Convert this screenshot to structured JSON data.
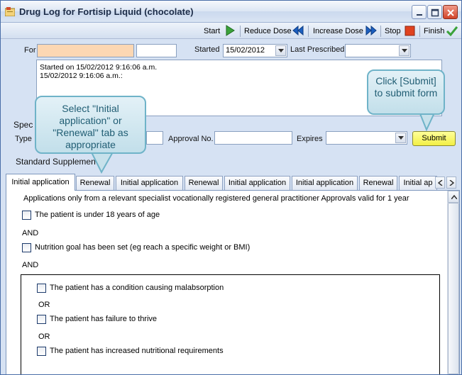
{
  "window": {
    "title": "Drug Log for Fortisip Liquid (chocolate)"
  },
  "toolbar": {
    "start": "Start",
    "reduce_dose": "Reduce Dose",
    "increase_dose": "Increase Dose",
    "stop": "Stop",
    "finish": "Finish"
  },
  "form": {
    "for_label": "For",
    "for_value": "",
    "for_extra_value": "",
    "started_label": "Started",
    "started_value": "15/02/2012",
    "last_prescribed_label": "Last Prescribed",
    "last_prescribed_value": "",
    "notes_lines": [
      "Started on 15/02/2012 9:16:06 a.m.",
      "15/02/2012 9:16:06 a.m.:"
    ]
  },
  "approval": {
    "section_label_partial": "Spec",
    "type_label": "Type",
    "type_value": "",
    "approval_no_label": "Approval No.",
    "approval_no_value": "",
    "expires_label": "Expires",
    "expires_value": "",
    "submit_label": "Submit",
    "standard_supplements_partial": "Standard Supplemen"
  },
  "callouts": {
    "tabs_hint": "Select \"Initial application\" or \"Renewal\" tab as appropriate",
    "submit_hint": "Click [Submit] to submit form"
  },
  "tabs": [
    {
      "label": "Initial application",
      "active": true
    },
    {
      "label": "Renewal",
      "active": false
    },
    {
      "label": "Initial application",
      "active": false
    },
    {
      "label": "Renewal",
      "active": false
    },
    {
      "label": "Initial application",
      "active": false
    },
    {
      "label": "Initial application",
      "active": false
    },
    {
      "label": "Renewal",
      "active": false
    },
    {
      "label": "Initial ap",
      "active": false
    }
  ],
  "panel": {
    "intro": "Applications only from a  relevant specialist vocationally registered general practitioner Approvals valid for 1 year",
    "criteria": [
      {
        "text": "The patient is under 18 years of age",
        "checked": false
      },
      {
        "text": "Nutrition goal has been set (eg reach a specific weight or BMI)",
        "checked": false
      }
    ],
    "and_1": "AND",
    "and_2": "AND",
    "group": {
      "items": [
        {
          "text": "The patient has a condition causing malabsorption",
          "checked": false
        },
        {
          "text": "The patient has failure to thrive",
          "checked": false
        },
        {
          "text": "The patient has increased nutritional requirements",
          "checked": false
        }
      ],
      "or_1": "OR",
      "or_2": "OR"
    }
  },
  "colors": {
    "window_bg": "#d6e2f3",
    "for_field_bg": "#fcd7b3",
    "submit_bg": "#f2ef44",
    "callout_bg": "#c2dfea",
    "callout_text": "#215e74",
    "start_icon": "#3aa23a",
    "nav_icon": "#1c5fc0",
    "stop_icon": "#e0421f",
    "finish_icon": "#3aa23a"
  }
}
